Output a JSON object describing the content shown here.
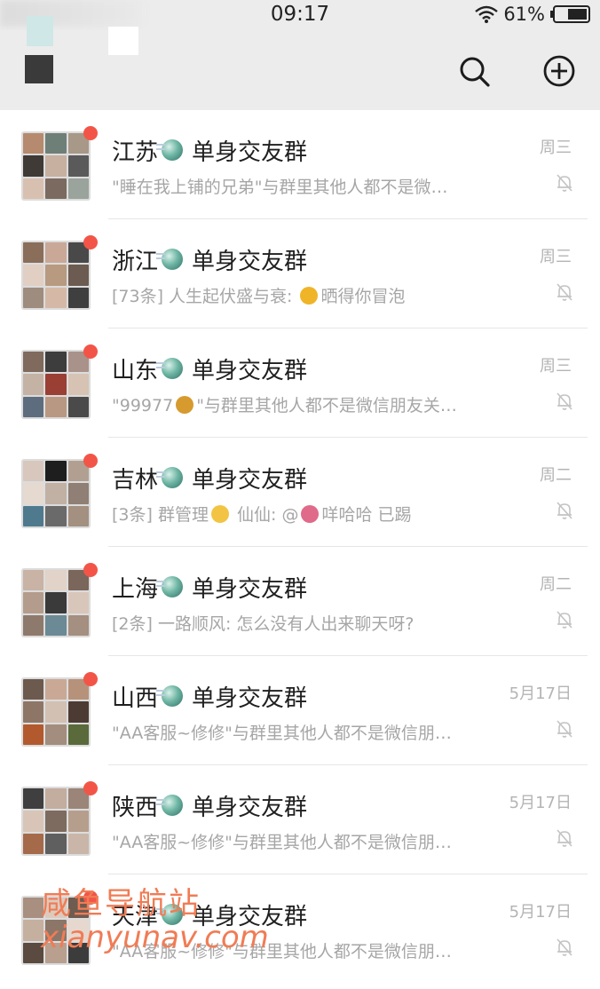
{
  "status_bar": {
    "time": "09:17",
    "battery": "61%"
  },
  "header": {
    "icons": [
      "search-icon",
      "add-icon"
    ]
  },
  "chats": [
    {
      "title_prefix": "江苏",
      "title_suffix": "单身交友群",
      "preview": "\"睡在我上铺的兄弟\"与群里其他人都不是微…",
      "time": "周三"
    },
    {
      "title_prefix": "浙江",
      "title_suffix": "单身交友群",
      "preview_before": "[73条] 人生起伏盛与衰: ",
      "preview_after": "晒得你冒泡",
      "emoji_color": "#f0b429",
      "time": "周三"
    },
    {
      "title_prefix": "山东",
      "title_suffix": "单身交友群",
      "preview_before": "\"99977",
      "preview_after": "\"与群里其他人都不是微信朋友关…",
      "emoji_color": "#d79a2e",
      "time": "周三"
    },
    {
      "title_prefix": "吉林",
      "title_suffix": "单身交友群",
      "preview_before": "[3条] 群管理",
      "preview_middle": " 仙仙: @",
      "preview_after": "咩哈哈 已踢",
      "emoji_color": "#f3c443",
      "emoji_color_2": "#e06a8a",
      "time": "周二"
    },
    {
      "title_prefix": "上海",
      "title_suffix": "单身交友群",
      "preview": "[2条] 一路顺风: 怎么没有人出来聊天呀?",
      "time": "周二"
    },
    {
      "title_prefix": "山西",
      "title_suffix": "单身交友群",
      "preview": "\"AA客服~修修\"与群里其他人都不是微信朋…",
      "time": "5月17日"
    },
    {
      "title_prefix": "陕西",
      "title_suffix": "单身交友群",
      "preview": "\"AA客服~修修\"与群里其他人都不是微信朋…",
      "time": "5月17日"
    },
    {
      "title_prefix": "天津",
      "title_suffix": "单身交友群",
      "preview": "\"AA客服~修修\"与群里其他人都不是微信朋…",
      "time": "5月17日"
    }
  ],
  "watermark": {
    "line1": "咸鱼导航站",
    "line2": "xianyunav.com"
  },
  "colors": {
    "badge": "#f25548",
    "watermark": "#f07c55",
    "preview_text": "#a6a6a6"
  }
}
